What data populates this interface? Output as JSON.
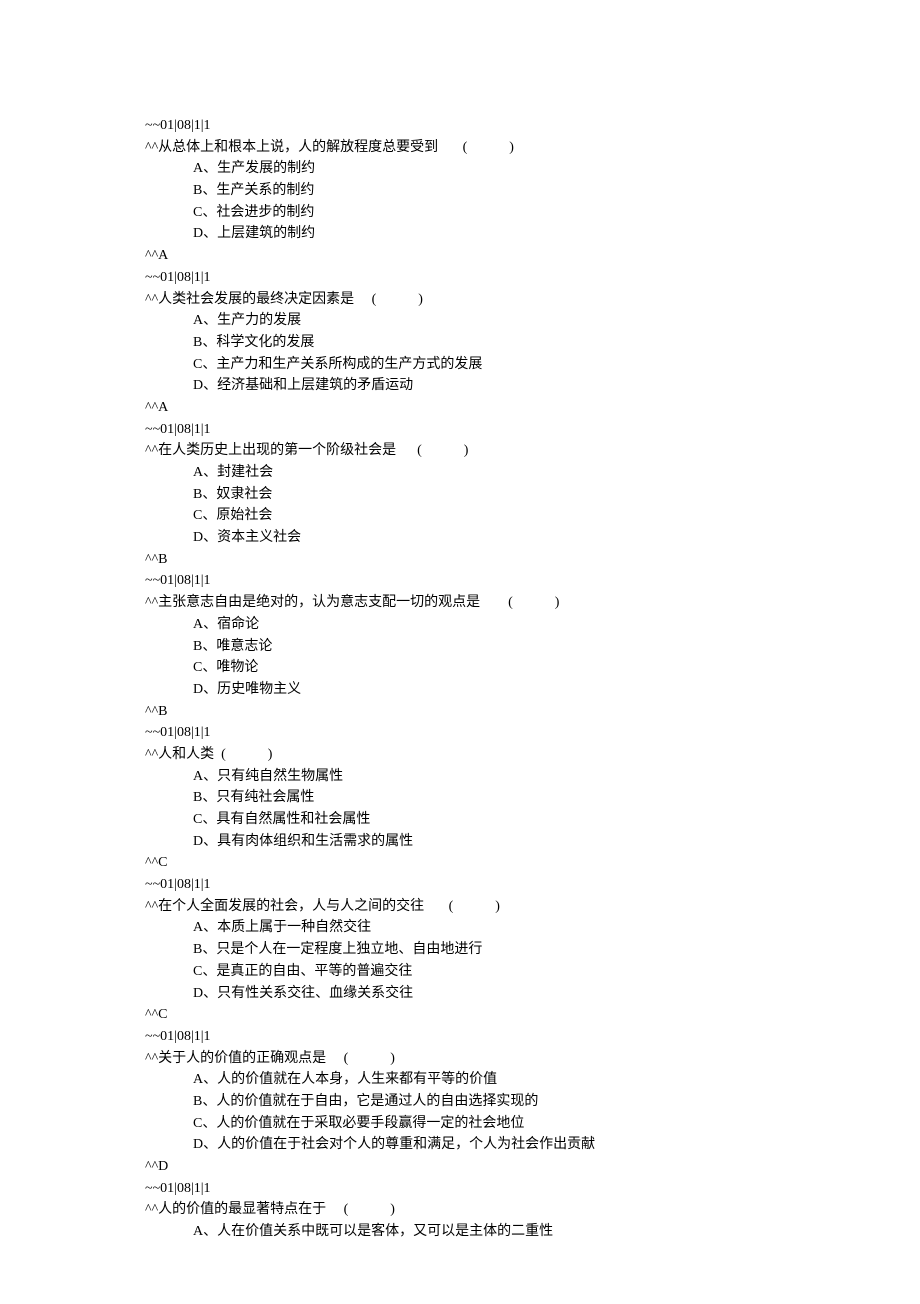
{
  "questions": [
    {
      "header": "~~01|08|1|1",
      "stem_prefix": "^^",
      "stem": "从总体上和根本上说，人的解放程度总要受到",
      "blank": "       (            )",
      "options": [
        "A、生产发展的制约",
        "B、生产关系的制约",
        "C、社会进步的制约",
        "D、上层建筑的制约"
      ],
      "answer_prefix": "^^",
      "answer": "A"
    },
    {
      "header": "~~01|08|1|1",
      "stem_prefix": "^^",
      "stem": "人类社会发展的最终决定因素是",
      "blank": "     (            )",
      "options": [
        "A、生产力的发展",
        "B、科学文化的发展",
        "C、主产力和生产关系所构成的生产方式的发展",
        "D、经济基础和上层建筑的矛盾运动"
      ],
      "answer_prefix": "^^",
      "answer": "A"
    },
    {
      "header": "~~01|08|1|1",
      "stem_prefix": "^^",
      "stem": "在人类历史上出现的第一个阶级社会是",
      "blank": "      (            )",
      "options": [
        "A、封建社会",
        "B、奴隶社会",
        "C、原始社会",
        "D、资本主义社会"
      ],
      "answer_prefix": "^^",
      "answer": "B"
    },
    {
      "header": "~~01|08|1|1",
      "stem_prefix": "^^",
      "stem": "主张意志自由是绝对的，认为意志支配一切的观点是",
      "blank": "        (            )",
      "options": [
        "A、宿命论",
        "B、唯意志论",
        "C、唯物论",
        "D、历史唯物主义"
      ],
      "answer_prefix": "^^",
      "answer": "B"
    },
    {
      "header": "~~01|08|1|1",
      "stem_prefix": "^^",
      "stem": "人和人类",
      "blank": "  (            )",
      "options": [
        "A、只有纯自然生物属性",
        "B、只有纯社会属性",
        "C、具有自然属性和社会属性",
        "D、具有肉体组织和生活需求的属性"
      ],
      "answer_prefix": "^^",
      "answer": "C"
    },
    {
      "header": "~~01|08|1|1",
      "stem_prefix": "^^",
      "stem": "在个人全面发展的社会，人与人之间的交往",
      "blank": "       (            )",
      "options": [
        "A、本质上属于一种自然交往",
        "B、只是个人在一定程度上独立地、自由地进行",
        "C、是真正的自由、平等的普遍交往",
        "D、只有性关系交往、血缘关系交往"
      ],
      "answer_prefix": "^^",
      "answer": "C"
    },
    {
      "header": "~~01|08|1|1",
      "stem_prefix": "^^",
      "stem": "关于人的价值的正确观点是",
      "blank": "     (            )",
      "options": [
        "A、人的价值就在人本身，人生来都有平等的价值",
        "B、人的价值就在于自由，它是通过人的自由选择实现的",
        "C、人的价值就在于采取必要手段赢得一定的社会地位",
        "D、人的价值在于社会对个人的尊重和满足，个人为社会作出贡献"
      ],
      "answer_prefix": "^^",
      "answer": "D"
    },
    {
      "header": "~~01|08|1|1",
      "stem_prefix": "^^",
      "stem": "人的价值的最显著特点在于",
      "blank": "     (            )",
      "options": [
        "A、人在价值关系中既可以是客体，又可以是主体的二重性"
      ],
      "answer_prefix": "",
      "answer": ""
    }
  ]
}
